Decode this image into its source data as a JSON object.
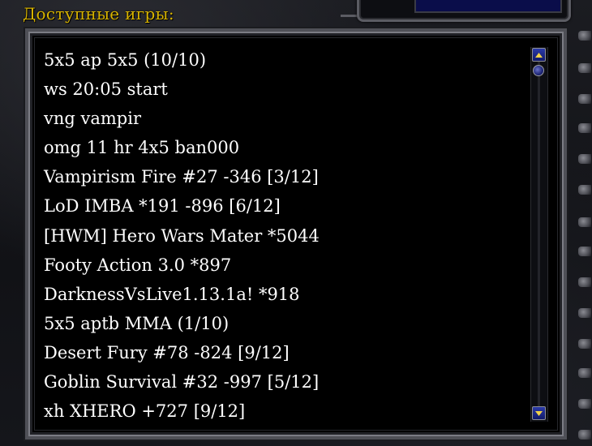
{
  "header": {
    "title": "Доступные игры:"
  },
  "games": [
    "5x5 ap 5x5  (10/10)",
    "ws 20:05 start",
    "vng vampir",
    "omg 11 hr 4x5 ban000",
    "Vampirism Fire #27 -346 [3/12]",
    "LoD IMBA *191 -896 [6/12]",
    "[HWM] Hero Wars Mater *5044",
    "Footy Action 3.0 *897",
    "DarknessVsLive1.13.1a! *918",
    "5x5 aptb MMA (1/10)",
    "Desert Fury #78 -824 [9/12]",
    "Goblin Survival #32 -997 [5/12]",
    "xh XHERO +727 [9/12]"
  ],
  "scrollbar": {
    "up_icon": "arrow-up-icon",
    "down_icon": "arrow-down-icon",
    "position": 0
  },
  "colors": {
    "title": "#d8b400",
    "list_text": "#ffffff",
    "list_background": "#000000",
    "scroll_button": "#2b3aa8"
  }
}
